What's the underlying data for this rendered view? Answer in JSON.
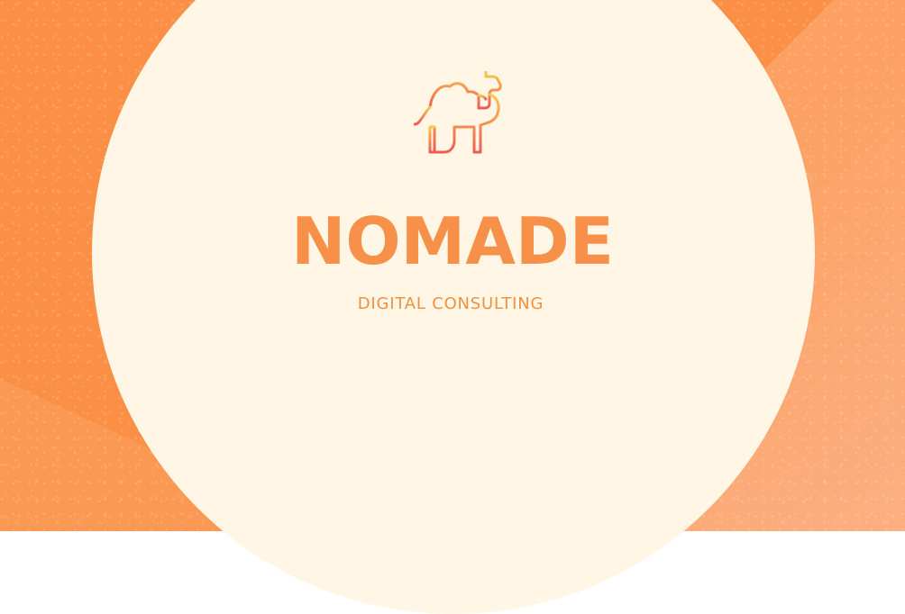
{
  "brand": {
    "title": "NOMADE",
    "subtitle": "DIGITAL CONSULTING"
  },
  "icons": {
    "logo": "camel-icon"
  },
  "colors": {
    "background": "#fb8f45",
    "circle": "#fff6e6",
    "title": "#f7914a",
    "subtitle": "#f0913f",
    "icon_gradient_start": "#f9c84e",
    "icon_gradient_end": "#ef5a53"
  }
}
